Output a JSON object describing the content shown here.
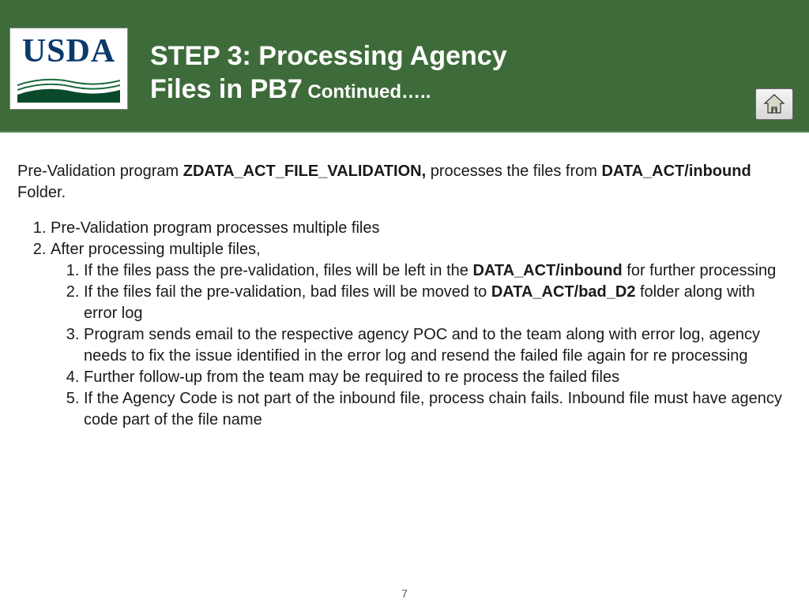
{
  "header": {
    "logo_text": "USDA",
    "title_line1": "STEP 3: Processing Agency",
    "title_line2_main": "Files in PB7",
    "title_line2_cont": " Continued….."
  },
  "intro": {
    "t1": "Pre-Validation program ",
    "b1": "ZDATA_ACT_FILE_VALIDATION,",
    "t2": " processes the files from ",
    "b2": "DATA_ACT/inbound",
    "t3": " Folder."
  },
  "list": {
    "item1": "Pre-Validation program processes multiple files",
    "item2": "After processing multiple files,",
    "sub1_a": "If the files pass the pre-validation, files will be left in the ",
    "sub1_b": "DATA_ACT/inbound",
    "sub1_c": " for further processing",
    "sub2_a": "If the files fail the pre-validation, bad files will be moved to ",
    "sub2_b": "DATA_ACT/bad_D2",
    "sub2_c": " folder along with error log",
    "sub3": "Program sends email to the respective agency POC and to the team along with error log, agency needs to fix the issue identified in the error log and resend the failed file again for re processing",
    "sub4": "Further follow-up from the team may be required to re process the failed files",
    "sub5": "If the Agency Code is not part of the inbound file, process chain fails. Inbound file must have agency code part of the file name"
  },
  "page_number": "7"
}
